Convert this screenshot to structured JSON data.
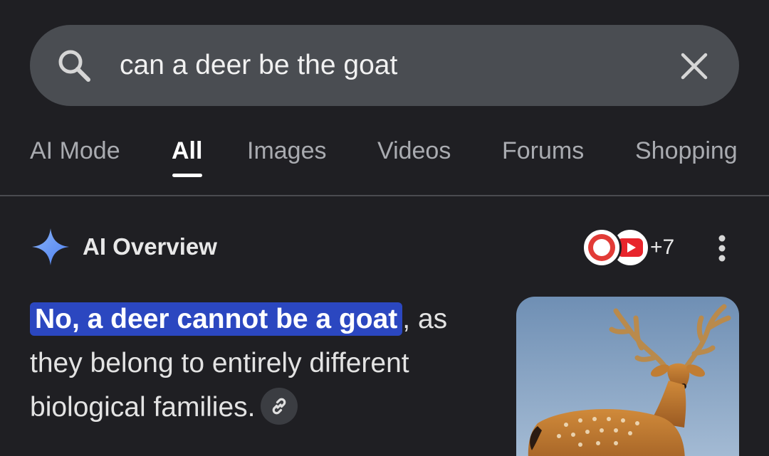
{
  "search": {
    "query": "can a deer be the goat"
  },
  "tabs": [
    {
      "label": "AI Mode"
    },
    {
      "label": "All"
    },
    {
      "label": "Images"
    },
    {
      "label": "Videos"
    },
    {
      "label": "Forums"
    },
    {
      "label": "Shopping"
    }
  ],
  "active_tab": "All",
  "overview": {
    "title": "AI Overview",
    "source_count": "+7",
    "answer_highlight": "No, a deer cannot be a goat",
    "answer_rest": ", as they belong to entirely different biological families."
  },
  "icons": {
    "search": "search-icon",
    "clear": "close-icon",
    "sparkle": "sparkle-icon",
    "more": "more-vert-icon",
    "link": "link-icon"
  },
  "colors": {
    "background": "#1f1f23",
    "search_bar": "#4a4d52",
    "highlight": "#2b47c0",
    "sparkle": "#6f9cf7"
  }
}
